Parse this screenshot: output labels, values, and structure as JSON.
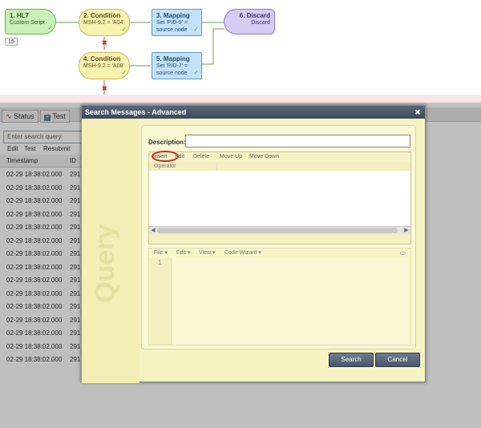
{
  "flow": {
    "nodes": [
      {
        "title": "1. HL7",
        "sub": "Custom Script",
        "badge": "15"
      },
      {
        "title": "2. Condition",
        "sub": "MSH-9.2 = 'A04'"
      },
      {
        "title": "3. Mapping",
        "sub": "Set 'PID-9' = source node"
      },
      {
        "title": "6. Discard",
        "sub": "Discard"
      },
      {
        "title": "4. Condition",
        "sub": "MSH-9.2 = 'A08'"
      },
      {
        "title": "5. Mapping",
        "sub": "Set 'PID-7' = source node"
      }
    ]
  },
  "bg": {
    "tabs": [
      "Status",
      "Test"
    ],
    "search_placeholder": "Enter search query",
    "menu": [
      "Edit",
      "Test",
      "Resubmit"
    ],
    "columns": [
      "Timestamp",
      "ID"
    ],
    "rows": [
      [
        "02-29 18:38:02.000",
        "291"
      ],
      [
        "02-29 18:38:02.000",
        "291"
      ],
      [
        "02-29 18:38:02.000",
        "291"
      ],
      [
        "02-29 18:38:02.000",
        "291"
      ],
      [
        "02-29 18:38:02.000",
        "291"
      ],
      [
        "02-29 18:38:02.000",
        "291"
      ],
      [
        "02-29 18:38:02.000",
        "291"
      ],
      [
        "02-29 18:38:02.000",
        "291"
      ],
      [
        "02-29 18:38:02.000",
        "291"
      ],
      [
        "02-29 18:38:02.000",
        "291"
      ],
      [
        "02-29 18:38:02.000",
        "291"
      ],
      [
        "02-29 18:38:02.000",
        "291"
      ],
      [
        "02-29 18:38:02.000",
        "291"
      ],
      [
        "02-29 18:38:02.000",
        "291"
      ],
      [
        "02-29 18:38:02.000",
        "291"
      ]
    ]
  },
  "dialog": {
    "title": "Search Messages - Advanced",
    "side_label": "Query",
    "description_label": "Description:",
    "description_value": "",
    "toolbar": [
      "Insert",
      "Edit",
      "Delete",
      "Move Up",
      "Move Down"
    ],
    "grid_header": "Operator",
    "code_menu": [
      "File",
      "Edit",
      "View",
      "Code Wizard"
    ],
    "line_number": "1",
    "search_button": "Search",
    "cancel_button": "Cancel"
  }
}
